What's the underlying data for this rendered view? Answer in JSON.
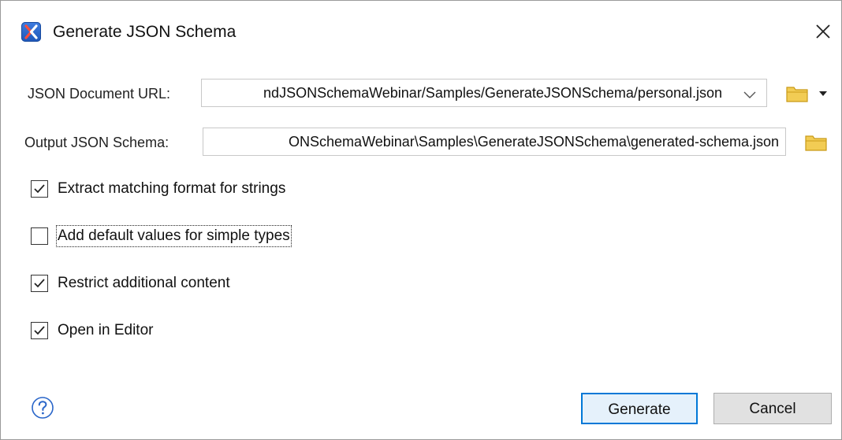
{
  "window": {
    "title": "Generate JSON Schema",
    "icon": "oxygen-app-icon",
    "close_icon": "close-icon"
  },
  "form": {
    "json_url": {
      "label": "JSON Document URL:",
      "value": "ndJSONSchemaWebinar/Samples/GenerateJSONSchema/personal.json",
      "dropdown_icon": "chevron-down-icon",
      "browse_icon": "folder-icon",
      "browse_menu_icon": "triangle-down-icon"
    },
    "output_schema": {
      "label": "Output JSON Schema:",
      "value": "ONSchemaWebinar\\Samples\\GenerateJSONSchema\\generated-schema.json",
      "browse_icon": "folder-icon"
    },
    "options": [
      {
        "label": "Extract matching format for strings",
        "checked": true
      },
      {
        "label": "Add default values for simple types",
        "checked": false
      },
      {
        "label": "Restrict additional content",
        "checked": true
      },
      {
        "label": "Open in Editor",
        "checked": true
      }
    ]
  },
  "footer": {
    "help_icon": "help-icon",
    "generate_label": "Generate",
    "cancel_label": "Cancel"
  },
  "colors": {
    "accent": "#0078d7",
    "folder": "#e8b923",
    "icon_blue": "#2a66c9"
  }
}
